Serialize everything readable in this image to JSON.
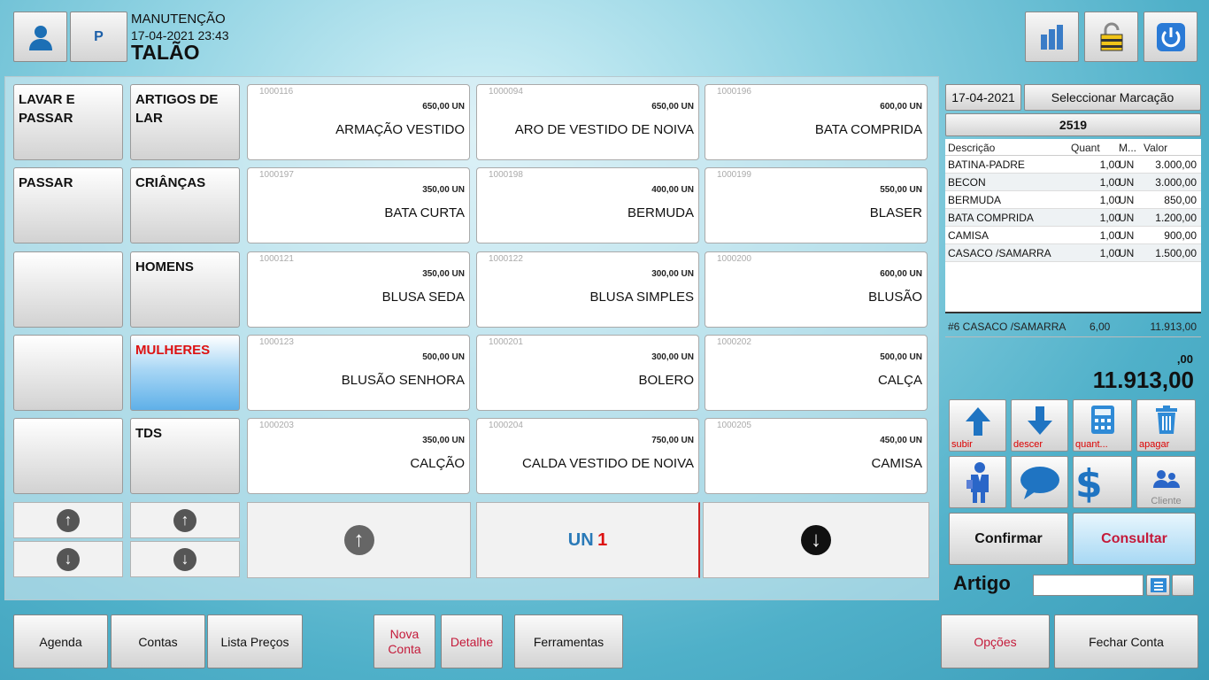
{
  "header": {
    "mode": "MANUTENÇÃO",
    "datetime": "17-04-2021 23:43",
    "doc_type": "TALÃO",
    "user_btn": "P"
  },
  "categories": [
    {
      "label": "LAVAR  E\nPASSAR"
    },
    {
      "label": "ARTIGOS DE\nLAR"
    },
    {
      "label": "PASSAR"
    },
    {
      "label": "CRIÂNÇAS"
    },
    {
      "label": ""
    },
    {
      "label": "HOMENS"
    },
    {
      "label": ""
    },
    {
      "label": "MULHERES"
    },
    {
      "label": ""
    },
    {
      "label": "TDS"
    }
  ],
  "items": [
    {
      "code": "1000116",
      "price": "650,00 UN",
      "name": "ARMAÇÃO VESTIDO"
    },
    {
      "code": "1000094",
      "price": "650,00 UN",
      "name": "ARO DE VESTIDO DE NOIVA"
    },
    {
      "code": "1000196",
      "price": "600,00 UN",
      "name": "BATA COMPRIDA"
    },
    {
      "code": "1000197",
      "price": "350,00 UN",
      "name": "BATA CURTA"
    },
    {
      "code": "1000198",
      "price": "400,00 UN",
      "name": "BERMUDA"
    },
    {
      "code": "1000199",
      "price": "550,00 UN",
      "name": "BLASER"
    },
    {
      "code": "1000121",
      "price": "350,00 UN",
      "name": "BLUSA SEDA"
    },
    {
      "code": "1000122",
      "price": "300,00 UN",
      "name": "BLUSA SIMPLES"
    },
    {
      "code": "1000200",
      "price": "600,00 UN",
      "name": "BLUSÃO"
    },
    {
      "code": "1000123",
      "price": "500,00 UN",
      "name": "BLUSÃO SENHORA"
    },
    {
      "code": "1000201",
      "price": "300,00 UN",
      "name": "BOLERO"
    },
    {
      "code": "1000202",
      "price": "500,00 UN",
      "name": "CALÇA"
    },
    {
      "code": "1000203",
      "price": "350,00 UN",
      "name": "CALÇÃO"
    },
    {
      "code": "1000204",
      "price": "750,00 UN",
      "name": "CALDA VESTIDO DE NOIVA"
    },
    {
      "code": "1000205",
      "price": "450,00 UN",
      "name": "CAMISA"
    }
  ],
  "unit": {
    "label": "UN",
    "qty": "1"
  },
  "right": {
    "date": "17-04-2021",
    "select_label": "Seleccionar Marcação",
    "number": "2519",
    "columns": [
      "Descrição",
      "Quant",
      "M...",
      "Valor"
    ],
    "rows": [
      {
        "desc": "BATINA-PADRE",
        "qty": "1,00",
        "m": "UN",
        "val": "3.000,00"
      },
      {
        "desc": "BECON",
        "qty": "1,00",
        "m": "UN",
        "val": "3.000,00"
      },
      {
        "desc": "BERMUDA",
        "qty": "1,00",
        "m": "UN",
        "val": "850,00"
      },
      {
        "desc": "BATA COMPRIDA",
        "qty": "1,00",
        "m": "UN",
        "val": "1.200,00"
      },
      {
        "desc": "CAMISA",
        "qty": "1,00",
        "m": "UN",
        "val": "900,00"
      },
      {
        "desc": "CASACO /SAMARRA",
        "qty": "1,00",
        "m": "UN",
        "val": "1.500,00"
      }
    ],
    "summary": {
      "desc": "#6 CASACO /SAMARRA",
      "qty": "6,00",
      "val": "11.913,00"
    },
    "small_total": ",00",
    "total": "11.913,00",
    "actions": [
      "subir",
      "descer",
      "quant...",
      "apagar"
    ],
    "cliente": "Cliente",
    "confirm": "Confirmar",
    "consult": "Consultar",
    "artigo_label": "Artigo",
    "artigo_value": ""
  },
  "bottom": {
    "agenda": "Agenda",
    "contas": "Contas",
    "lista": "Lista Preços",
    "nova": "Nova\nConta",
    "detalhe": "Detalhe",
    "ferramentas": "Ferramentas",
    "opcoes": "Opções",
    "fechar": "Fechar Conta"
  }
}
